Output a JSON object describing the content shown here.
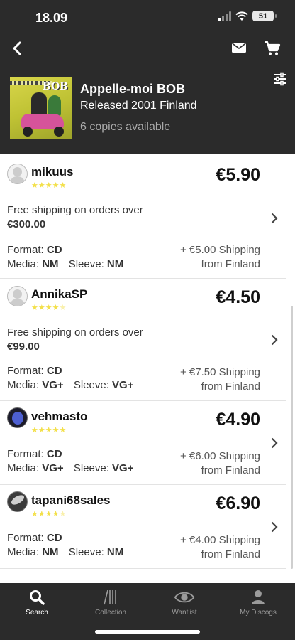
{
  "status_bar": {
    "time": "18.09",
    "battery": "51"
  },
  "release": {
    "title": "Appelle-moi BOB",
    "subtitle": "Released 2001 Finland",
    "copies": "6 copies available",
    "cover_text": "BOB"
  },
  "listings": [
    {
      "seller": "mikuus",
      "stars": "★★★★★",
      "price": "€5.90",
      "offer_text": "Free shipping on orders over",
      "offer_amount": "€300.00",
      "format_label": "Format:",
      "format": "CD",
      "media_label": "Media:",
      "media": "NM",
      "sleeve_label": "Sleeve:",
      "sleeve": "NM",
      "shipping": "+ €5.00 Shipping",
      "origin": "from Finland"
    },
    {
      "seller": "AnnikaSP",
      "stars": "★★★★",
      "stars_half": "★",
      "price": "€4.50",
      "offer_text": "Free shipping on orders over",
      "offer_amount": "€99.00",
      "format_label": "Format:",
      "format": "CD",
      "media_label": "Media:",
      "media": "VG+",
      "sleeve_label": "Sleeve:",
      "sleeve": "VG+",
      "shipping": "+ €7.50 Shipping",
      "origin": "from Finland"
    },
    {
      "seller": "vehmasto",
      "stars": "★★★★★",
      "price": "€4.90",
      "format_label": "Format:",
      "format": "CD",
      "media_label": "Media:",
      "media": "VG+",
      "sleeve_label": "Sleeve:",
      "sleeve": "VG+",
      "shipping": "+ €6.00 Shipping",
      "origin": "from Finland"
    },
    {
      "seller": "tapani68sales",
      "stars": "★★★★",
      "stars_half": "★",
      "price": "€6.90",
      "format_label": "Format:",
      "format": "CD",
      "media_label": "Media:",
      "media": "NM",
      "sleeve_label": "Sleeve:",
      "sleeve": "NM",
      "shipping": "+ €4.00 Shipping",
      "origin": "from Finland"
    }
  ],
  "tabs": [
    {
      "label": "Search",
      "icon": "search-icon",
      "active": true
    },
    {
      "label": "Collection",
      "icon": "collection-icon"
    },
    {
      "label": "Wantlist",
      "icon": "eye-icon"
    },
    {
      "label": "My Discogs",
      "icon": "user-icon"
    }
  ],
  "colors": {
    "header_bg": "#2b2b2b",
    "star": "#f3e04a",
    "tab_active": "#ffffff",
    "tab_inactive": "#9b9b9b"
  }
}
